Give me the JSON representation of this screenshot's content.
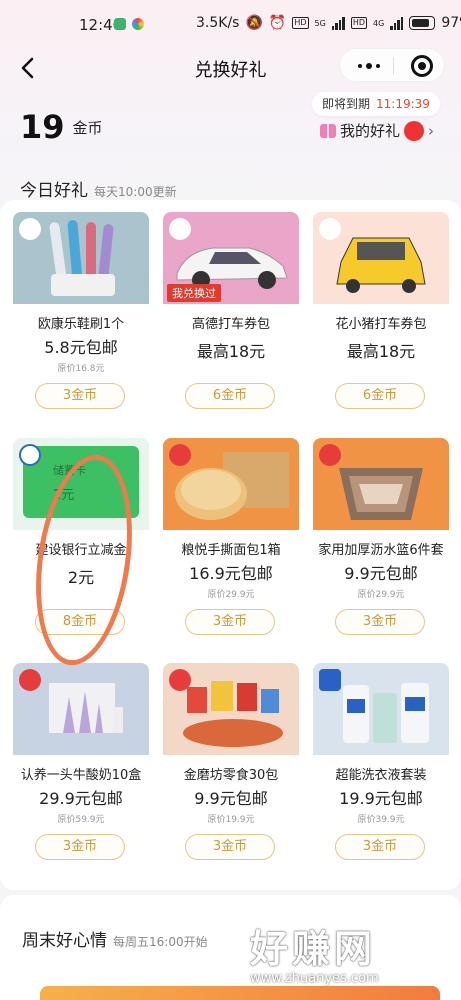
{
  "status_bar": {
    "time": "12:40",
    "network_speed": "3.5K/s",
    "battery": "97%",
    "net1": "5G",
    "net2": "4G",
    "hd": "HD"
  },
  "nav": {
    "title": "兑换好礼"
  },
  "expire": {
    "label": "即将到期",
    "countdown": "11:19:39"
  },
  "coins": {
    "value": "19",
    "unit": "金币"
  },
  "my_gift": {
    "label": "我的好礼"
  },
  "today": {
    "title": "今日好礼",
    "subtitle": "每天10:00更新"
  },
  "products": [
    {
      "name": "欧康乐鞋刷1个",
      "price": "5.8元包邮",
      "original": "原价16.8元",
      "cost": "3金币",
      "stamp": ""
    },
    {
      "name": "高德打车券包",
      "price": "最高18元",
      "original": "",
      "cost": "6金币",
      "stamp": "我兑换过"
    },
    {
      "name": "花小猪打车券包",
      "price": "最高18元",
      "original": "",
      "cost": "6金币",
      "stamp": ""
    },
    {
      "name": "建设银行立减金",
      "price": "2元",
      "original": "",
      "cost": "8金币",
      "stamp": "",
      "card_text": "储蓄卡",
      "card_value": "2元"
    },
    {
      "name": "粮悦手撕面包1箱",
      "price": "16.9元包邮",
      "original": "原价29.9元",
      "cost": "3金币",
      "stamp": ""
    },
    {
      "name": "家用加厚沥水篮6件套",
      "price": "9.9元包邮",
      "original": "原价29.9元",
      "cost": "3金币",
      "stamp": ""
    },
    {
      "name": "认养一头牛酸奶10盒",
      "price": "29.9元包邮",
      "original": "原价59.9元",
      "cost": "3金币",
      "stamp": ""
    },
    {
      "name": "金磨坊零食30包",
      "price": "9.9元包邮",
      "original": "原价19.9元",
      "cost": "3金币",
      "stamp": ""
    },
    {
      "name": "超能洗衣液套装",
      "price": "19.9元包邮",
      "original": "原价39.9元",
      "cost": "3金币",
      "stamp": ""
    }
  ],
  "weekend": {
    "title": "周末好心情",
    "subtitle": "每周五16:00开始"
  },
  "watermark": {
    "text": "好赚网",
    "url": "www.zhuanyes.com"
  },
  "colors": {
    "accent": "#e5472c",
    "gold": "#c79a41",
    "annotation": "#ee7a4e"
  }
}
